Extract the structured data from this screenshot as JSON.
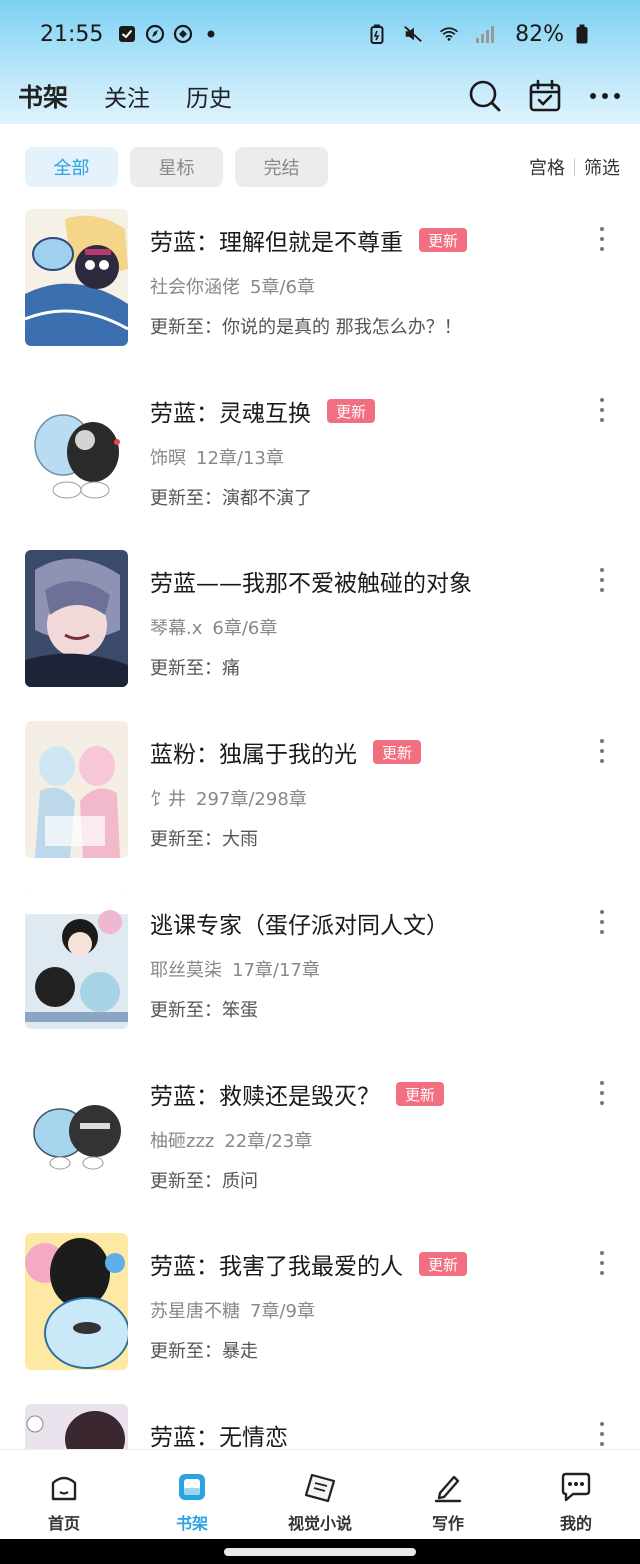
{
  "status_bar": {
    "time": "21:55",
    "battery": "82%"
  },
  "header": {
    "tabs": [
      {
        "label": "书架",
        "active": true
      },
      {
        "label": "关注",
        "active": false
      },
      {
        "label": "历史",
        "active": false
      }
    ]
  },
  "filters": {
    "chips": [
      {
        "label": "全部",
        "active": true
      },
      {
        "label": "星标",
        "active": false
      },
      {
        "label": "完结",
        "active": false
      }
    ],
    "grid_label": "宫格",
    "filter_label": "筛选"
  },
  "books": [
    {
      "title": "劳蓝：理解但就是不尊重",
      "badge": "更新",
      "author": "社会你涵佬",
      "chapters": "5章/6章",
      "update": "更新至：你说的是真的 那我怎么办？！"
    },
    {
      "title": "劳蓝：灵魂互换",
      "badge": "更新",
      "author": "饰暝",
      "chapters": "12章/13章",
      "update": "更新至：演都不演了"
    },
    {
      "title": "劳蓝——我那不爱被触碰的对象",
      "badge": "",
      "author": "琴幕.x",
      "chapters": "6章/6章",
      "update": "更新至：痛"
    },
    {
      "title": "蓝粉：独属于我的光",
      "badge": "更新",
      "author": "饣井",
      "chapters": "297章/298章",
      "update": "更新至：大雨"
    },
    {
      "title": "逃课专家（蛋仔派对同人文）",
      "badge": "",
      "author": "耶丝莫柒",
      "chapters": "17章/17章",
      "update": "更新至：笨蛋"
    },
    {
      "title": "劳蓝：救赎还是毁灭？",
      "badge": "更新",
      "author": "柚砸zzz",
      "chapters": "22章/23章",
      "update": "更新至：质问"
    },
    {
      "title": "劳蓝：我害了我最爱的人",
      "badge": "更新",
      "author": "苏星唐不糖",
      "chapters": "7章/9章",
      "update": "更新至：暴走"
    },
    {
      "title": "劳蓝：无情恋",
      "badge": "",
      "author": "",
      "chapters": "",
      "update": ""
    }
  ],
  "bottom_nav": [
    {
      "label": "首页",
      "icon": "home-icon",
      "active": false
    },
    {
      "label": "书架",
      "icon": "bookshelf-icon",
      "active": true
    },
    {
      "label": "视觉小说",
      "icon": "visual-novel-icon",
      "active": false
    },
    {
      "label": "写作",
      "icon": "pen-icon",
      "active": false
    },
    {
      "label": "我的",
      "icon": "chat-icon",
      "active": false
    }
  ],
  "colors": {
    "accent": "#2ca2e0",
    "badge": "#f26f80",
    "header_gradient_top": "#7cd1f3"
  }
}
